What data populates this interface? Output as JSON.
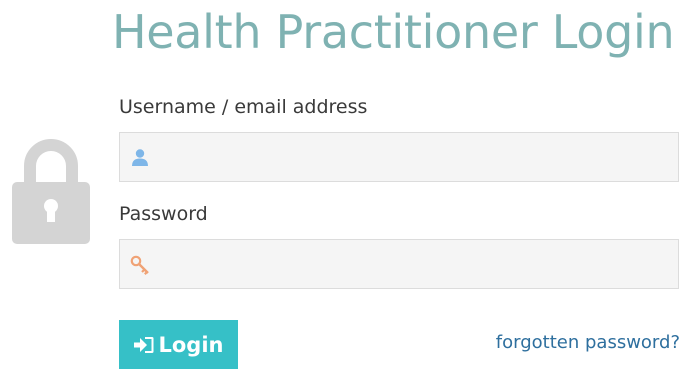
{
  "header": {
    "title": "Health Practitioner Login"
  },
  "form": {
    "username": {
      "label": "Username / email address",
      "value": "",
      "placeholder": "",
      "icon": "user-icon"
    },
    "password": {
      "label": "Password",
      "value": "",
      "placeholder": "",
      "icon": "key-icon"
    },
    "submit": {
      "label": "Login",
      "icon": "sign-in-icon"
    },
    "forgot_link": "forgotten password?"
  },
  "decor": {
    "icon": "padlock-icon"
  },
  "colors": {
    "title": "#7fb2b2",
    "button": "#36c0c7",
    "link": "#2e6f9e",
    "lock": "#d4d4d4",
    "user_icon": "#7eb6e8",
    "key_icon": "#f0a275"
  }
}
